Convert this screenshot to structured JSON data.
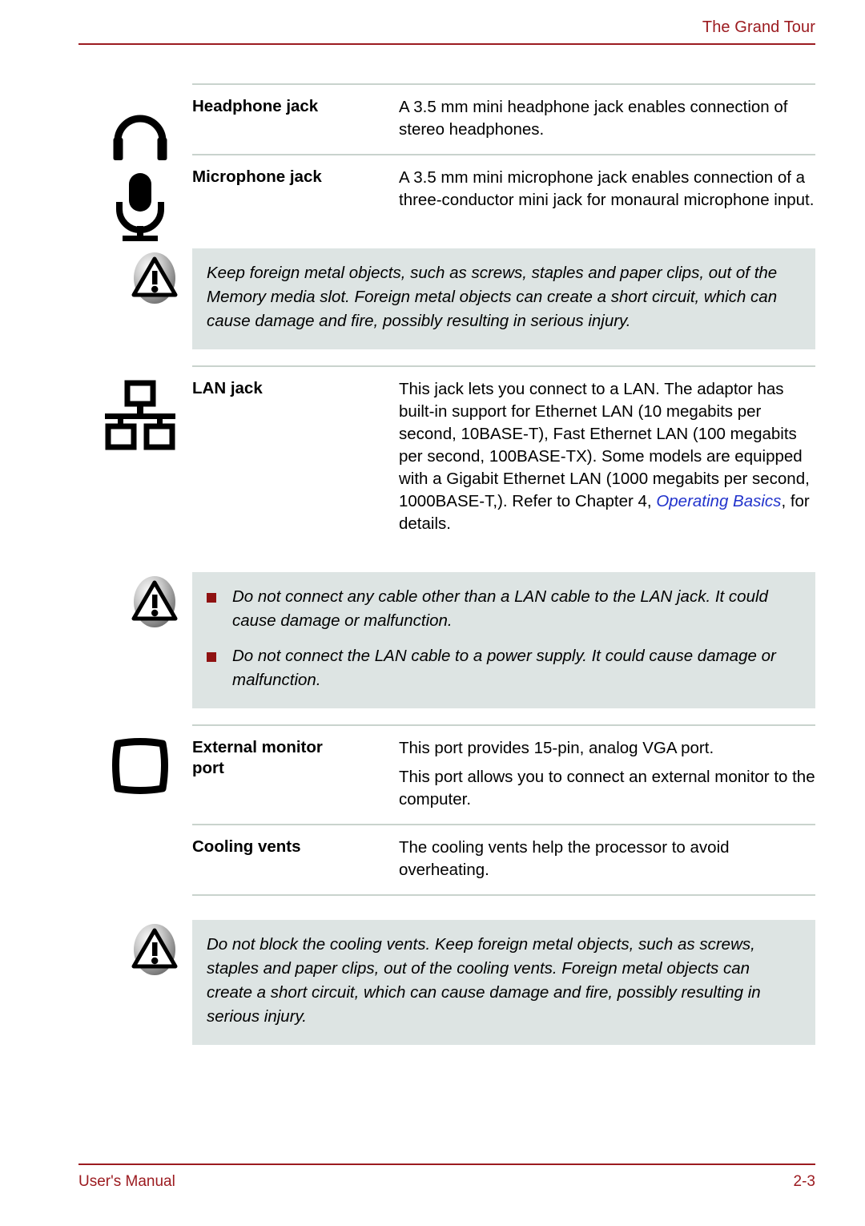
{
  "header": {
    "title": "The Grand Tour"
  },
  "footer": {
    "manual_label": "User's Manual",
    "page_number": "2-3"
  },
  "colors": {
    "accent_red": "#9c1b20",
    "bullet_red": "#8f1212",
    "caution_bg": "#dde4e3",
    "rule_gray": "#c9d3cd",
    "xref_blue": "#2233cc"
  },
  "spec_rows": [
    {
      "icon": "headphone-icon",
      "label": "Headphone jack",
      "paragraphs": [
        "A 3.5 mm mini headphone jack enables connection of stereo headphones."
      ]
    },
    {
      "icon": "microphone-icon",
      "label": "Microphone jack",
      "paragraphs": [
        "A 3.5 mm mini microphone jack enables connection of a three-conductor mini jack for monaural microphone input."
      ]
    },
    {
      "icon": "lan-network-icon",
      "label": "LAN jack",
      "paragraphs": [
        "This jack lets you connect to a LAN. The adaptor has built-in support for Ethernet LAN (10 megabits per second, 10BASE-T), Fast Ethernet LAN (100 megabits per second, 100BASE-TX). Some models are equipped with a Gigabit Ethernet LAN (1000 megabits per second, 1000BASE-T,). Refer to Chapter 4, "
      ],
      "xref": "Operating Basics",
      "xref_tail": ", for details."
    },
    {
      "icon": "monitor-icon",
      "label_line1": "External monitor",
      "label_line2": "port",
      "paragraphs": [
        "This port provides 15-pin, analog VGA port.",
        "This port allows you to connect an external monitor to the computer."
      ]
    },
    {
      "icon": "",
      "label": "Cooling vents",
      "paragraphs": [
        "The cooling vents help the processor to avoid overheating."
      ]
    }
  ],
  "cautions": [
    {
      "icon": "warning-triangle-icon",
      "text": "Keep foreign metal objects, such as screws, staples and paper clips, out of the Memory media slot. Foreign metal objects can create a short circuit, which can cause damage and fire, possibly resulting in serious injury."
    },
    {
      "icon": "warning-triangle-icon",
      "bullets": [
        "Do not connect any cable other than a LAN cable to the LAN jack. It could cause damage or malfunction.",
        "Do not connect the LAN cable to a power supply. It could cause damage or malfunction."
      ]
    },
    {
      "icon": "warning-triangle-icon",
      "text": "Do not block the cooling vents. Keep foreign metal objects, such as screws, staples and paper clips, out of the cooling vents. Foreign metal objects can create a short circuit, which can cause damage and fire, possibly resulting in serious injury."
    }
  ]
}
